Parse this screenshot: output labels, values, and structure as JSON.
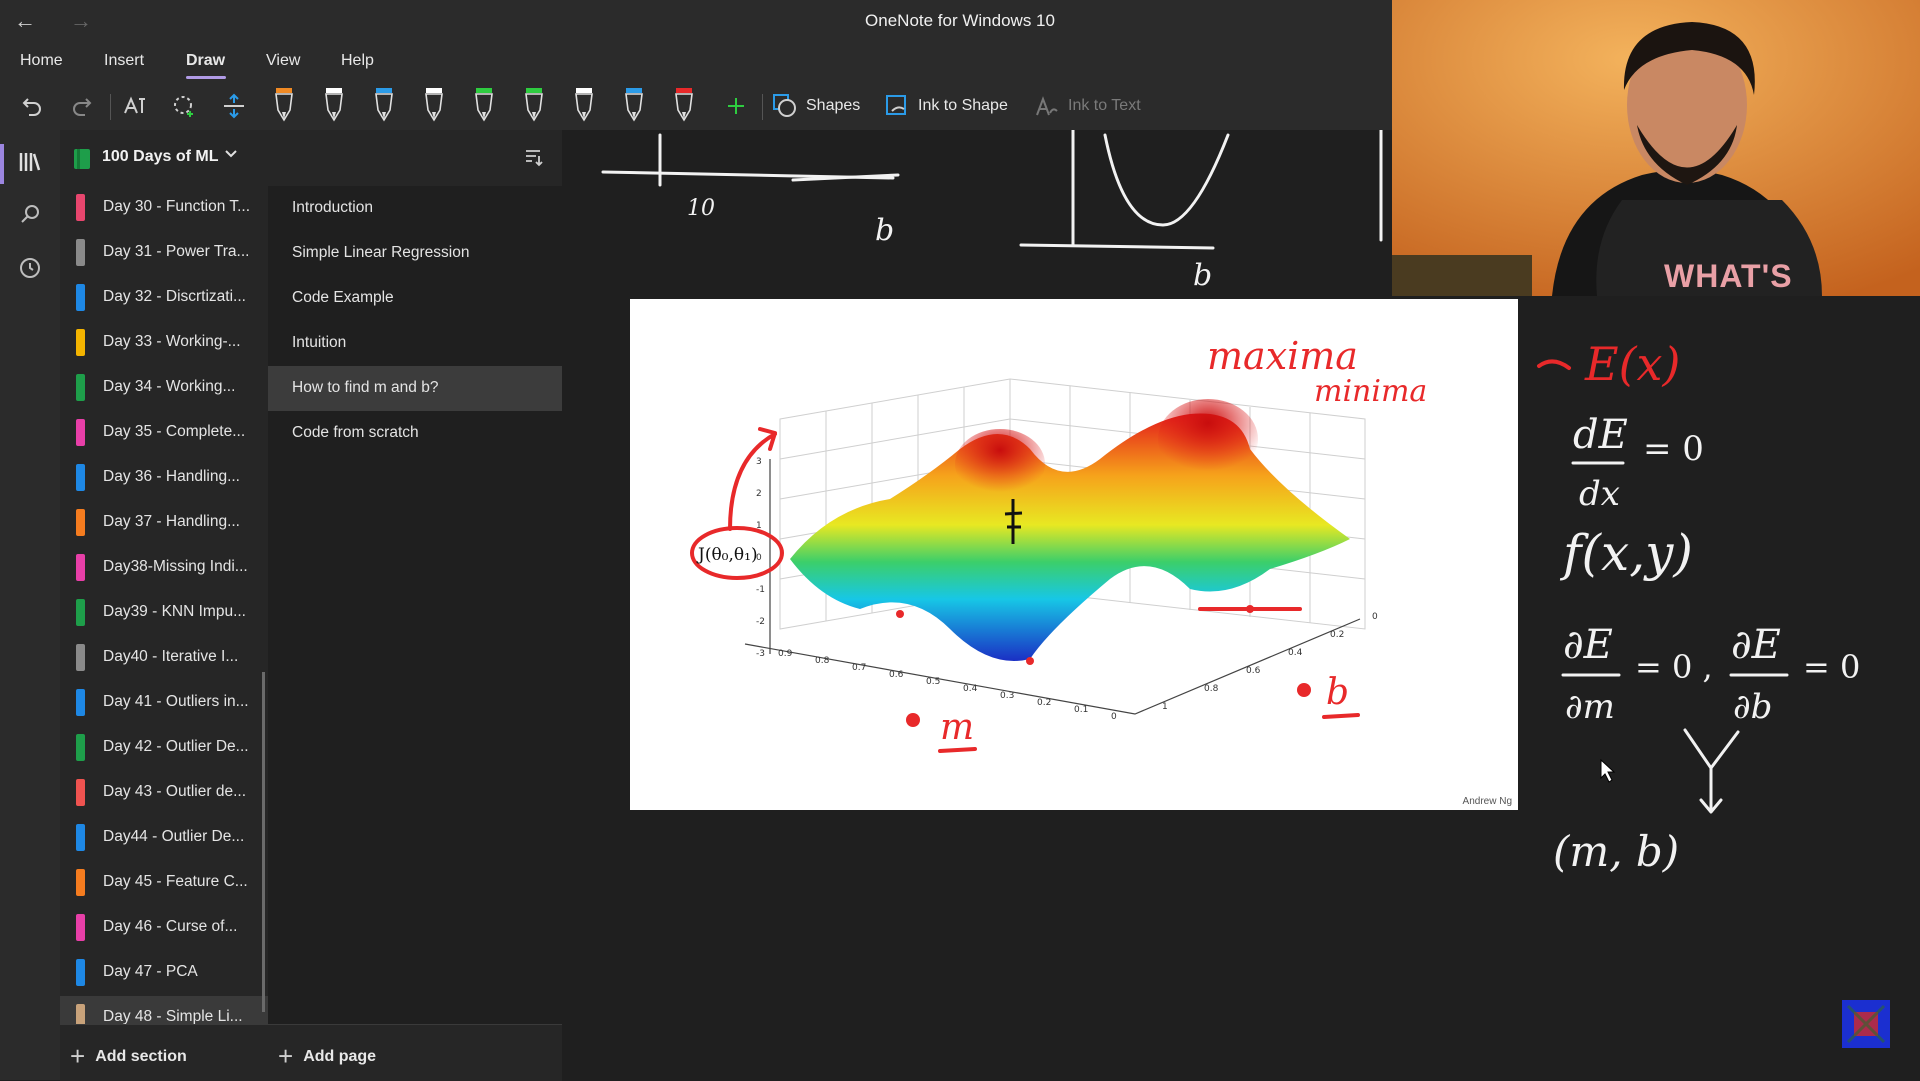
{
  "app": {
    "title": "OneNote for Windows 10"
  },
  "menu": {
    "items": [
      "Home",
      "Insert",
      "Draw",
      "View",
      "Help"
    ],
    "active": "Draw"
  },
  "toolbar": {
    "shapes_label": "Shapes",
    "ink_to_shape_label": "Ink to Shape",
    "ink_to_text_label": "Ink to Text",
    "pen_colors": [
      "#f08a24",
      "#ffffff",
      "#2b9be8",
      "#ffffff",
      "#2ecc40",
      "#2ecc40",
      "#ffffff",
      "#2b9be8",
      "#e8292a"
    ]
  },
  "notebook": {
    "title": "100 Days of ML"
  },
  "sections": [
    {
      "label": "Day 30 - Function T...",
      "color": "#e8466e"
    },
    {
      "label": "Day 31 - Power Tra...",
      "color": "#8a8a8a"
    },
    {
      "label": "Day 32 - Discrtizati...",
      "color": "#1e88e5"
    },
    {
      "label": "Day 33 - Working-...",
      "color": "#f4b400"
    },
    {
      "label": "Day 34 - Working...",
      "color": "#1e9e4a"
    },
    {
      "label": "Day 35 - Complete...",
      "color": "#e83fa8"
    },
    {
      "label": "Day 36 - Handling...",
      "color": "#1e88e5"
    },
    {
      "label": "Day 37 - Handling...",
      "color": "#f57c1f"
    },
    {
      "label": "Day38-Missing Indi...",
      "color": "#e83fa8"
    },
    {
      "label": "Day39 - KNN Impu...",
      "color": "#1e9e4a"
    },
    {
      "label": "Day40 - Iterative I...",
      "color": "#8a8a8a"
    },
    {
      "label": "Day 41 - Outliers in...",
      "color": "#1e88e5"
    },
    {
      "label": "Day 42 - Outlier De...",
      "color": "#1e9e4a"
    },
    {
      "label": "Day 43 - Outlier de...",
      "color": "#ef5350"
    },
    {
      "label": "Day44 - Outlier De...",
      "color": "#1e88e5"
    },
    {
      "label": "Day 45 - Feature C...",
      "color": "#f57c1f"
    },
    {
      "label": "Day 46 - Curse of...",
      "color": "#e83fa8"
    },
    {
      "label": "Day 47 - PCA",
      "color": "#1e88e5"
    },
    {
      "label": "Day 48 - Simple Li...",
      "color": "#c8a27a"
    }
  ],
  "selected_section": "Day 48 - Simple Li...",
  "pages": [
    {
      "label": "Introduction"
    },
    {
      "label": "Simple Linear Regression"
    },
    {
      "label": "Code Example"
    },
    {
      "label": "Intuition"
    },
    {
      "label": "How to find m and b?"
    },
    {
      "label": "Code from scratch"
    }
  ],
  "selected_page": "How to find m and b?",
  "bottom": {
    "add_section": "Add section",
    "add_page": "Add page"
  },
  "slide": {
    "credit": "Andrew Ng",
    "z_ticks": [
      "3",
      "2",
      "1",
      "0",
      "-1",
      "-2",
      "-3"
    ],
    "x_ticks": [
      "0.9",
      "0.8",
      "0.7",
      "0.6",
      "0.5",
      "0.4",
      "0.3",
      "0.2",
      "0.1",
      "0"
    ],
    "y_ticks": [
      "0",
      "0.2",
      "0.4",
      "0.6",
      "0.8",
      "1"
    ],
    "cost_label": "J(θ₀,θ₁)"
  },
  "handwriting": {
    "canvas_top": [
      "10",
      "b",
      "b"
    ],
    "slide_annotations": [
      "maxima",
      "minima",
      "m",
      "b"
    ],
    "right_notes": [
      "E(x)",
      "dE",
      "dx",
      "= 0",
      "f(x,y)",
      "∂E",
      "∂m",
      "= 0 ,",
      "∂E",
      "∂b",
      "= 0",
      "(m, b)"
    ]
  },
  "webcam": {
    "shirt_text": "WHAT'S"
  }
}
